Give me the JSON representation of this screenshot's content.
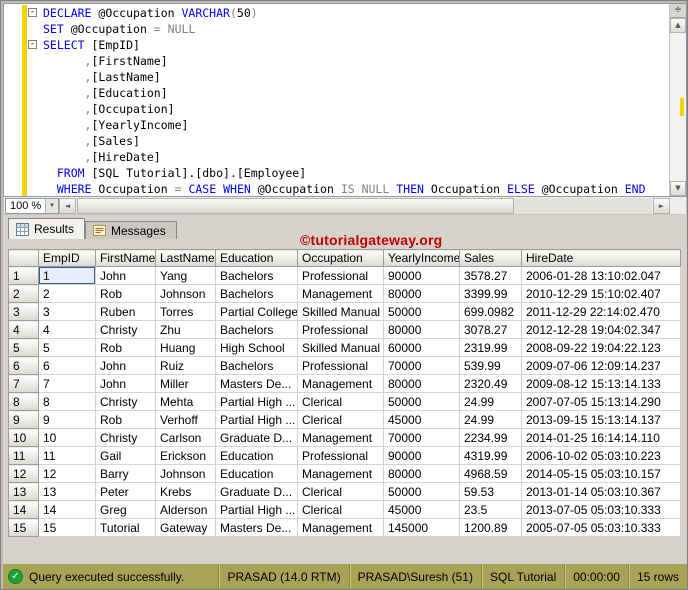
{
  "editor": {
    "zoom_label": "100 %",
    "lines": [
      {
        "fold": true,
        "tokens": [
          [
            "k",
            "DECLARE"
          ],
          [
            "t",
            " @Occupation "
          ],
          [
            "k",
            "VARCHAR"
          ],
          [
            "g",
            "("
          ],
          [
            "t",
            "50"
          ],
          [
            "g",
            ")"
          ]
        ]
      },
      {
        "fold": false,
        "tokens": [
          [
            "k",
            "SET"
          ],
          [
            "t",
            " @Occupation "
          ],
          [
            "g",
            "="
          ],
          [
            "t",
            " "
          ],
          [
            "g",
            "NULL"
          ]
        ]
      },
      {
        "fold": true,
        "tokens": [
          [
            "k",
            "SELECT"
          ],
          [
            "t",
            " [EmpID]"
          ]
        ]
      },
      {
        "fold": false,
        "tokens": [
          [
            "t",
            "      "
          ],
          [
            "g",
            ","
          ],
          [
            "t",
            "[FirstName]"
          ]
        ]
      },
      {
        "fold": false,
        "tokens": [
          [
            "t",
            "      "
          ],
          [
            "g",
            ","
          ],
          [
            "t",
            "[LastName]"
          ]
        ]
      },
      {
        "fold": false,
        "tokens": [
          [
            "t",
            "      "
          ],
          [
            "g",
            ","
          ],
          [
            "t",
            "[Education]"
          ]
        ]
      },
      {
        "fold": false,
        "tokens": [
          [
            "t",
            "      "
          ],
          [
            "g",
            ","
          ],
          [
            "t",
            "[Occupation]"
          ]
        ]
      },
      {
        "fold": false,
        "tokens": [
          [
            "t",
            "      "
          ],
          [
            "g",
            ","
          ],
          [
            "t",
            "[YearlyIncome]"
          ]
        ]
      },
      {
        "fold": false,
        "tokens": [
          [
            "t",
            "      "
          ],
          [
            "g",
            ","
          ],
          [
            "t",
            "[Sales]"
          ]
        ]
      },
      {
        "fold": false,
        "tokens": [
          [
            "t",
            "      "
          ],
          [
            "g",
            ","
          ],
          [
            "t",
            "[HireDate]"
          ]
        ]
      },
      {
        "fold": false,
        "tokens": [
          [
            "t",
            "  "
          ],
          [
            "k",
            "FROM"
          ],
          [
            "t",
            " [SQL Tutorial].[dbo].[Employee]"
          ]
        ]
      },
      {
        "fold": false,
        "tokens": [
          [
            "t",
            "  "
          ],
          [
            "k",
            "WHERE"
          ],
          [
            "t",
            " Occupation "
          ],
          [
            "g",
            "="
          ],
          [
            "t",
            " "
          ],
          [
            "k",
            "CASE"
          ],
          [
            "t",
            " "
          ],
          [
            "k",
            "WHEN"
          ],
          [
            "t",
            " @Occupation "
          ],
          [
            "g",
            "IS NULL"
          ],
          [
            "t",
            " "
          ],
          [
            "k",
            "THEN"
          ],
          [
            "t",
            " Occupation "
          ],
          [
            "k",
            "ELSE"
          ],
          [
            "t",
            " @Occupation "
          ],
          [
            "k",
            "END"
          ]
        ]
      }
    ]
  },
  "tabs": {
    "results": "Results",
    "messages": "Messages"
  },
  "watermark": "©tutorialgateway.org",
  "grid": {
    "columns": [
      "EmpID",
      "FirstName",
      "LastName",
      "Education",
      "Occupation",
      "YearlyIncome",
      "Sales",
      "HireDate"
    ],
    "rows": [
      [
        "1",
        "John",
        "Yang",
        "Bachelors",
        "Professional",
        "90000",
        "3578.27",
        "2006-01-28 13:10:02.047"
      ],
      [
        "2",
        "Rob",
        "Johnson",
        "Bachelors",
        "Management",
        "80000",
        "3399.99",
        "2010-12-29 15:10:02.407"
      ],
      [
        "3",
        "Ruben",
        "Torres",
        "Partial College",
        "Skilled Manual",
        "50000",
        "699.0982",
        "2011-12-29 22:14:02.470"
      ],
      [
        "4",
        "Christy",
        "Zhu",
        "Bachelors",
        "Professional",
        "80000",
        "3078.27",
        "2012-12-28 19:04:02.347"
      ],
      [
        "5",
        "Rob",
        "Huang",
        "High School",
        "Skilled Manual",
        "60000",
        "2319.99",
        "2008-09-22 19:04:22.123"
      ],
      [
        "6",
        "John",
        "Ruiz",
        "Bachelors",
        "Professional",
        "70000",
        "539.99",
        "2009-07-06 12:09:14.237"
      ],
      [
        "7",
        "John",
        "Miller",
        "Masters De...",
        "Management",
        "80000",
        "2320.49",
        "2009-08-12 15:13:14.133"
      ],
      [
        "8",
        "Christy",
        "Mehta",
        "Partial High ...",
        "Clerical",
        "50000",
        "24.99",
        "2007-07-05 15:13:14.290"
      ],
      [
        "9",
        "Rob",
        "Verhoff",
        "Partial High ...",
        "Clerical",
        "45000",
        "24.99",
        "2013-09-15 15:13:14.137"
      ],
      [
        "10",
        "Christy",
        "Carlson",
        "Graduate D...",
        "Management",
        "70000",
        "2234.99",
        "2014-01-25 16:14:14.110"
      ],
      [
        "11",
        "Gail",
        "Erickson",
        "Education",
        "Professional",
        "90000",
        "4319.99",
        "2006-10-02 05:03:10.223"
      ],
      [
        "12",
        "Barry",
        "Johnson",
        "Education",
        "Management",
        "80000",
        "4968.59",
        "2014-05-15 05:03:10.157"
      ],
      [
        "13",
        "Peter",
        "Krebs",
        "Graduate D...",
        "Clerical",
        "50000",
        "59.53",
        "2013-01-14 05:03:10.367"
      ],
      [
        "14",
        "Greg",
        "Alderson",
        "Partial High ...",
        "Clerical",
        "45000",
        "23.5",
        "2013-07-05 05:03:10.333"
      ],
      [
        "15",
        "Tutorial",
        "Gateway",
        "Masters De...",
        "Management",
        "145000",
        "1200.89",
        "2005-07-05 05:03:10.333"
      ]
    ]
  },
  "status_bar": {
    "message": "Query executed successfully.",
    "segments": [
      "PRASAD (14.0 RTM)",
      "PRASAD\\Suresh (51)",
      "SQL Tutorial",
      "00:00:00",
      "15 rows"
    ]
  },
  "icons": {
    "results_tab": "results-grid-icon",
    "messages_tab": "messages-icon",
    "status": "success-check-icon",
    "zoom": "chevron-down-icon",
    "fold": "collapse-region-button"
  },
  "colors": {
    "kw": "#0000ff",
    "gray": "#808080",
    "watermark": "#c00000",
    "status-bg": "#a8a457",
    "change": "#f8d200",
    "focus": "#2a5fa0"
  }
}
